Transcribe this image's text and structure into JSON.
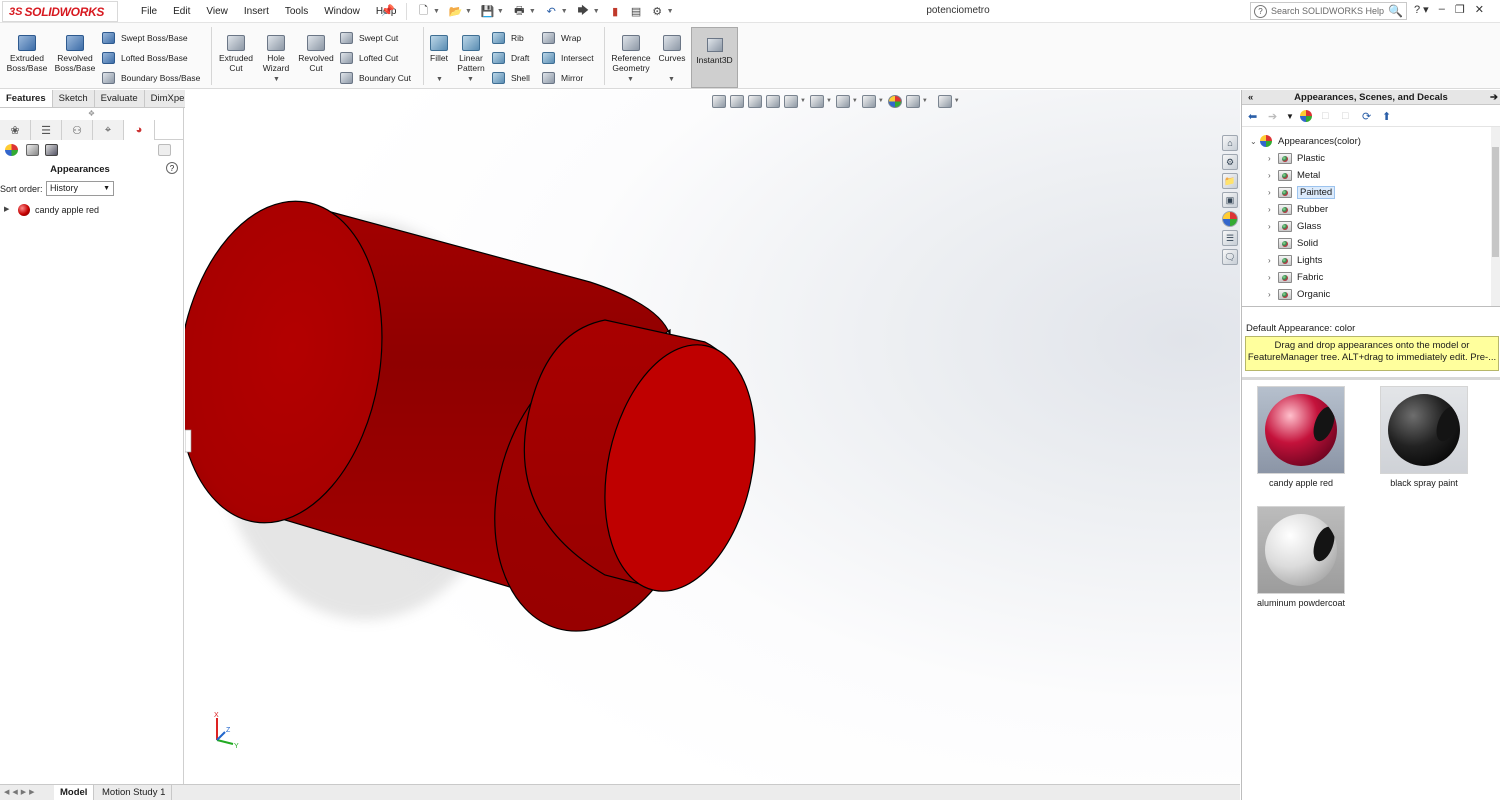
{
  "app": {
    "logo_ds": "3S",
    "logo_name": "SOLIDWORKS",
    "doc_title": "potenciometro",
    "search_placeholder": "Search SOLIDWORKS Help",
    "menus": [
      "File",
      "Edit",
      "View",
      "Insert",
      "Tools",
      "Window",
      "Help"
    ]
  },
  "ribbon": {
    "extruded_boss": "Extruded\nBoss/Base",
    "revolved_boss": "Revolved\nBoss/Base",
    "swept_boss": "Swept Boss/Base",
    "lofted_boss": "Lofted Boss/Base",
    "boundary_boss": "Boundary Boss/Base",
    "extruded_cut": "Extruded\nCut",
    "hole_wizard": "Hole\nWizard",
    "revolved_cut": "Revolved\nCut",
    "swept_cut": "Swept Cut",
    "lofted_cut": "Lofted Cut",
    "boundary_cut": "Boundary Cut",
    "fillet": "Fillet",
    "linear_pattern": "Linear\nPattern",
    "rib": "Rib",
    "draft": "Draft",
    "shell": "Shell",
    "wrap": "Wrap",
    "intersect": "Intersect",
    "mirror": "Mirror",
    "reference_geometry": "Reference\nGeometry",
    "curves": "Curves",
    "instant3d": "Instant3D"
  },
  "command_tabs": [
    "Features",
    "Sketch",
    "Evaluate",
    "DimXpert"
  ],
  "left_panel": {
    "title": "Appearances",
    "sort_label": "Sort order:",
    "sort_value": "History",
    "item_label": "candy apple red",
    "item_color": "#c40000"
  },
  "bottom_tabs": [
    "Model",
    "Motion Study 1"
  ],
  "triad": {
    "x": "X",
    "y": "Y",
    "z": "Z"
  },
  "right_panel": {
    "title": "Appearances, Scenes, and Decals",
    "tree_root": "Appearances(color)",
    "tree_items": [
      "Plastic",
      "Metal",
      "Painted",
      "Rubber",
      "Glass",
      "Solid",
      "Lights",
      "Fabric",
      "Organic"
    ],
    "selected": "Painted",
    "info_title": "Default Appearance: color",
    "tip_line1": "Drag and drop appearances onto the model or",
    "tip_line2": "FeatureManager tree.  ALT+drag to immediately edit.  Pre-...",
    "swatches": [
      "candy apple red",
      "black spray paint",
      "aluminum powdercoat"
    ]
  },
  "colors": {
    "model_red": "#b10000",
    "model_dark_red": "#8a0000",
    "tip_yellow": "#ffff9d"
  }
}
